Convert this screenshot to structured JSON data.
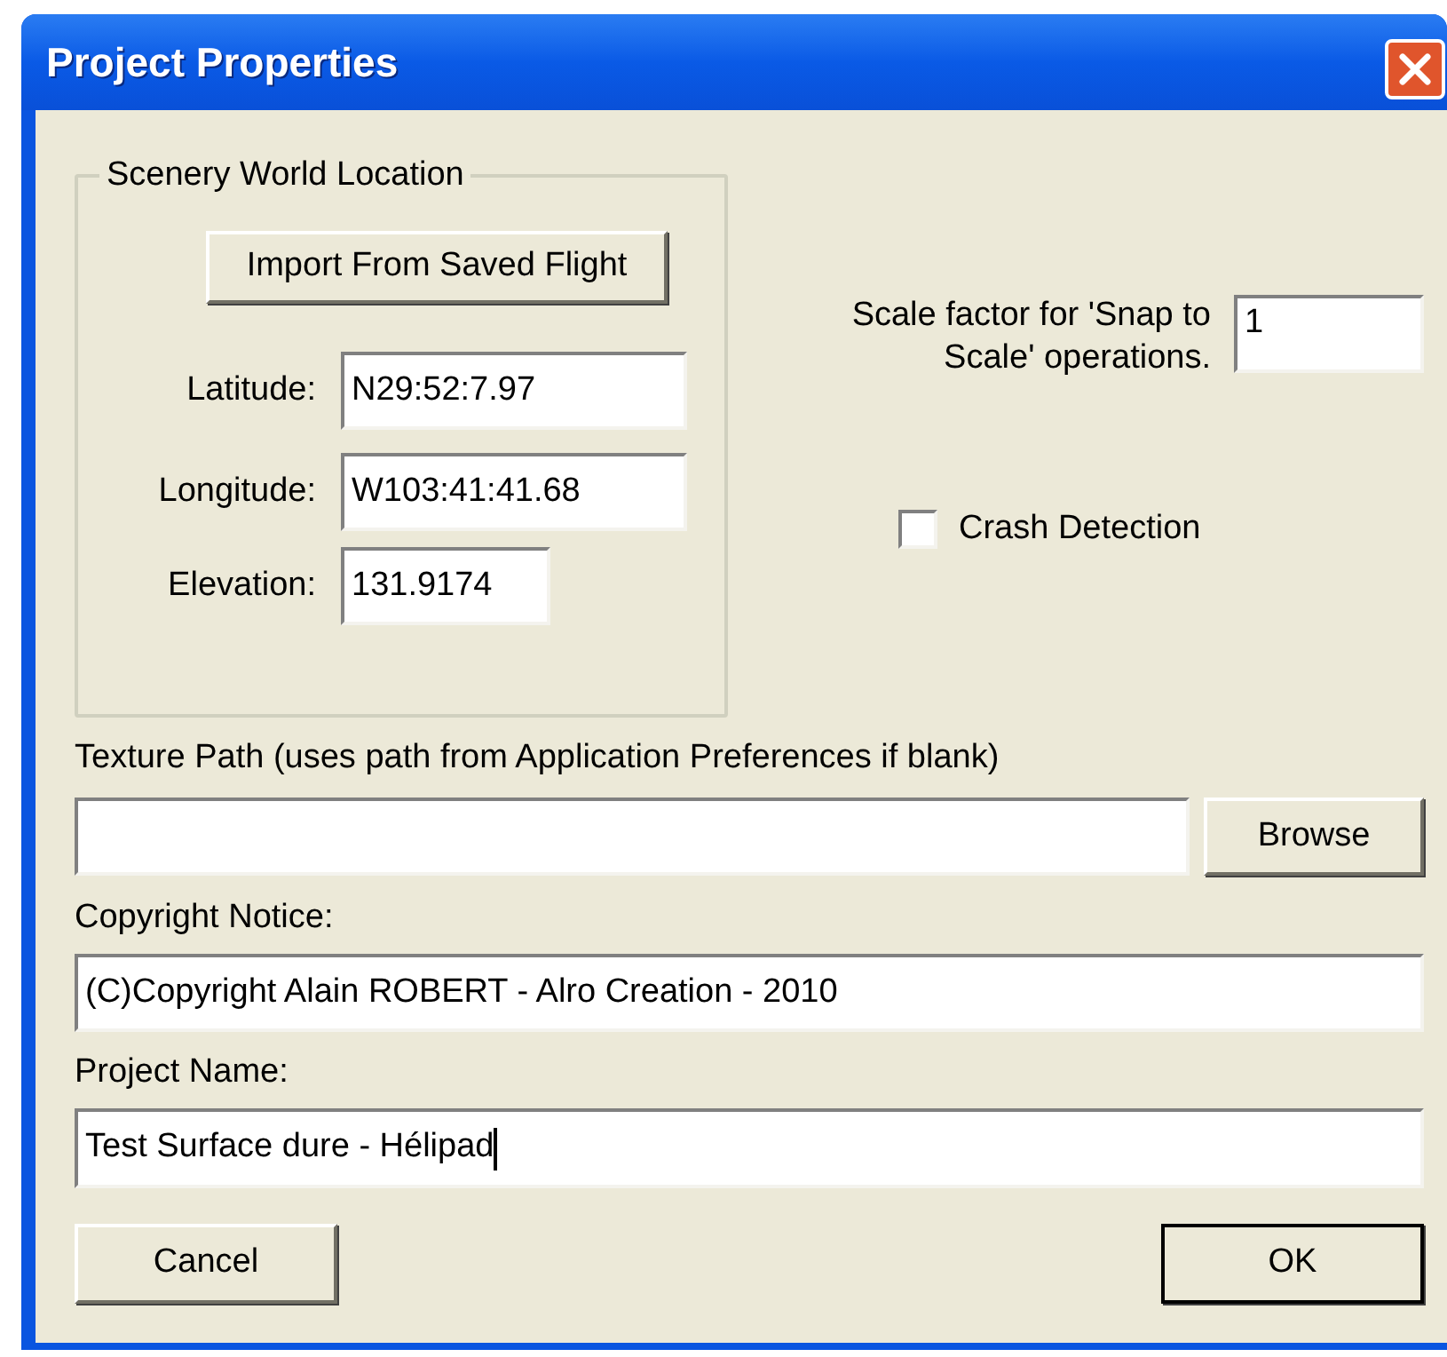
{
  "window": {
    "title": "Project Properties"
  },
  "location_group": {
    "title": "Scenery World Location",
    "import_button": "Import From Saved Flight",
    "fields": [
      {
        "label": "Latitude:",
        "value": "N29:52:7.97",
        "kind": "wide"
      },
      {
        "label": "Longitude:",
        "value": "W103:41:41.68",
        "kind": "wide"
      },
      {
        "label": "Elevation:",
        "value": "131.9174",
        "kind": "narrow"
      }
    ]
  },
  "scale": {
    "label": "Scale factor for 'Snap to Scale' operations.",
    "value": "1"
  },
  "crash_detection": {
    "label": "Crash Detection",
    "checked": false
  },
  "texture_path": {
    "label": "Texture Path (uses path from Application Preferences if blank)",
    "browse_button": "Browse"
  },
  "copyright": {
    "label": "Copyright Notice:",
    "value": "(C)Copyright Alain ROBERT - Alro Creation - 2010"
  },
  "project_name": {
    "label": "Project Name:",
    "value": "Test Surface dure - Hélipad",
    "focused": true
  },
  "buttons": [
    {
      "label": "Cancel",
      "default": false
    },
    {
      "label": "OK",
      "default": true
    }
  ]
}
